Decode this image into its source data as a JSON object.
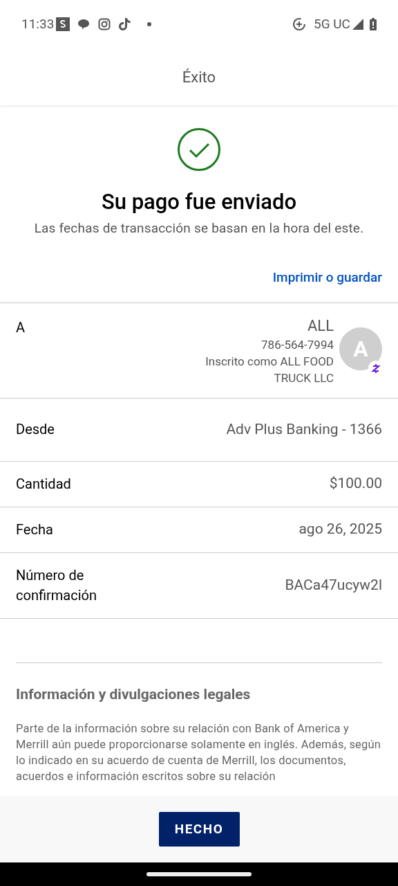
{
  "status_bar": {
    "time": "11:33",
    "network": "5G UC"
  },
  "header": {
    "title": "Éxito"
  },
  "success": {
    "title": "Su pago fue enviado",
    "subtitle": "Las fechas de transacción se basan en la hora del este."
  },
  "print_link": "Imprimir o guardar",
  "recipient": {
    "label": "A",
    "name": "ALL",
    "phone": "786-564-7994",
    "enrolled_line1": "Inscrito como ALL FOOD",
    "enrolled_line2": "TRUCK LLC",
    "avatar_letter": "A"
  },
  "details": [
    {
      "label": "Desde",
      "value": "Adv Plus Banking - 1366"
    },
    {
      "label": "Cantidad",
      "value": "$100.00"
    },
    {
      "label": "Fecha",
      "value": "ago 26, 2025"
    },
    {
      "label": "Número de confirmación",
      "value": "BACa47ucyw2l"
    }
  ],
  "legal": {
    "title": "Información y divulgaciones legales",
    "text": "Parte de la información sobre su relación con Bank of America y Merrill aún puede proporcionarse solamente en inglés. Además, según lo indicado en su acuerdo de cuenta de Merrill, los documentos, acuerdos e información escritos sobre su relación"
  },
  "done_button": "HECHO"
}
